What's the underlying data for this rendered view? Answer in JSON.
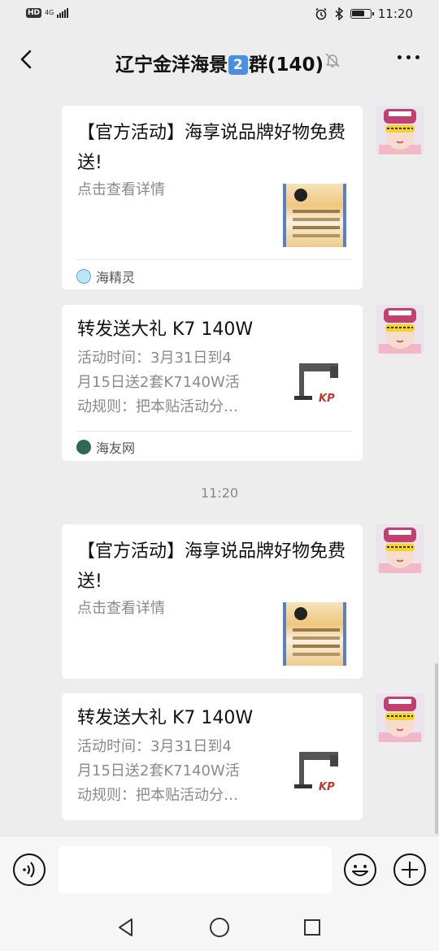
{
  "status_bar": {
    "hd": "HD",
    "network": "4G",
    "time": "11:20"
  },
  "header": {
    "title_prefix": "辽宁金洋海景",
    "title_badge": "2",
    "title_suffix": "群(140)"
  },
  "messages": [
    {
      "type": "mini-program",
      "title": "【官方活动】海享说品牌好物免费送!",
      "desc": "点击查看详情",
      "source": "海精灵",
      "source_icon": "ocean-icon"
    },
    {
      "type": "link",
      "title": "转发送大礼 K7 140W",
      "desc_lines": [
        "活动时间：3月31日到4",
        "月15日送2套K7140W活",
        "动规则：把本贴活动分…"
      ],
      "source": "海友网",
      "source_icon": "fish-icon",
      "thumb_brand": "KP"
    },
    {
      "type": "timestamp",
      "text": "11:20"
    },
    {
      "type": "mini-program",
      "title": "【官方活动】海享说品牌好物免费送!",
      "desc": "点击查看详情"
    },
    {
      "type": "link",
      "title": "转发送大礼 K7 140W",
      "desc_lines": [
        "活动时间：3月31日到4",
        "月15日送2套K7140W活",
        "动规则：把本贴活动分…"
      ],
      "thumb_brand": "KP"
    }
  ],
  "input": {
    "value": "",
    "placeholder": ""
  },
  "colors": {
    "background": "#ededed",
    "card": "#ffffff",
    "desc_gray": "#8a8a8a",
    "badge_blue": "#4a90e2",
    "input_bar": "#f6f6f6"
  }
}
